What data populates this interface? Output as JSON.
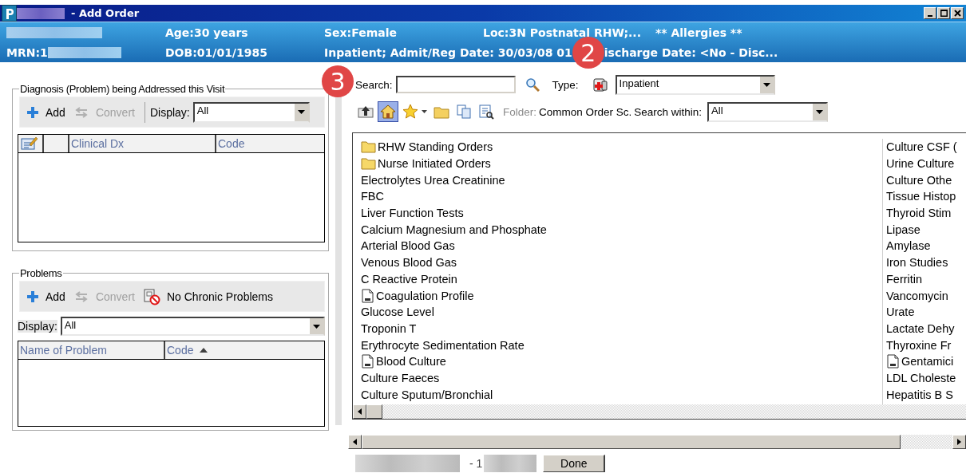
{
  "window": {
    "title": "- Add Order"
  },
  "banner": {
    "age": "Age:30 years",
    "sex": "Sex:Female",
    "location": "Loc:3N Postnatal RHW;...",
    "allergies": "** Allergies **",
    "mrn": "MRN:1",
    "dob": "DOB:01/01/1985",
    "encounter": "Inpatient; Admit/Reg Date: 30/03/08 01",
    "discharge": "ischarge Date: <No - Disc...",
    "callout": "2"
  },
  "diagnosis": {
    "title": "Diagnosis (Problem) being Addressed this Visit",
    "callout": "3",
    "toolbar": [
      {
        "kind": "add",
        "label": "Add",
        "disabled": false
      },
      {
        "kind": "convert",
        "label": "Convert",
        "disabled": true
      }
    ],
    "display_label": "Display:",
    "display_value": "All",
    "columns": [
      {
        "label": "Clinical Dx",
        "sorted": false
      },
      {
        "label": "Code",
        "sorted": false
      }
    ]
  },
  "problems": {
    "title": "Problems",
    "toolbar": [
      {
        "kind": "add",
        "label": "Add",
        "disabled": false
      },
      {
        "kind": "convert",
        "label": "Convert",
        "disabled": true
      },
      {
        "kind": "no-chronic",
        "label": "No Chronic Problems",
        "disabled": false
      }
    ],
    "display_label": "Display:",
    "display_value": "All",
    "columns": [
      {
        "label": "Name of Problem",
        "sorted": false
      },
      {
        "label": "Code",
        "sorted": true
      }
    ]
  },
  "orders": {
    "search_label": "Search:",
    "type_label": "Type:",
    "type_value": "Inpatient",
    "nav_buttons": [
      {
        "kind": "up",
        "selected": false
      },
      {
        "kind": "home",
        "selected": true
      },
      {
        "kind": "favorites",
        "selected": false
      },
      {
        "kind": "folder",
        "selected": false
      },
      {
        "kind": "copy",
        "selected": false
      },
      {
        "kind": "find",
        "selected": false
      }
    ],
    "folder_label": "Folder:",
    "folder_value": "Common Order Sc.",
    "search_within_label": "Search within:",
    "search_within_value": "All",
    "columns": [
      [
        {
          "kind": "folder",
          "text": "RHW Standing Orders"
        },
        {
          "kind": "folder",
          "text": "Nurse Initiated Orders"
        },
        {
          "kind": "order",
          "text": "Electrolytes Urea Creatinine"
        },
        {
          "kind": "order",
          "text": "FBC"
        },
        {
          "kind": "order",
          "text": "Liver Function Tests"
        },
        {
          "kind": "order",
          "text": "Calcium Magnesium and Phosphate"
        },
        {
          "kind": "order",
          "text": "Arterial Blood Gas"
        },
        {
          "kind": "order",
          "text": "Venous Blood Gas"
        },
        {
          "kind": "order",
          "text": "C Reactive Protein"
        },
        {
          "kind": "set",
          "text": "Coagulation Profile"
        },
        {
          "kind": "order",
          "text": "Glucose Level"
        },
        {
          "kind": "order",
          "text": "Troponin T"
        },
        {
          "kind": "order",
          "text": "Erythrocyte Sedimentation Rate"
        },
        {
          "kind": "set",
          "text": "Blood Culture"
        },
        {
          "kind": "order",
          "text": "Culture Faeces"
        },
        {
          "kind": "order",
          "text": "Culture Sputum/Bronchial"
        }
      ],
      [
        {
          "kind": "order",
          "text": "Culture CSF ("
        },
        {
          "kind": "order",
          "text": "Urine Culture"
        },
        {
          "kind": "order",
          "text": "Culture Othe"
        },
        {
          "kind": "order",
          "text": "Tissue Histop"
        },
        {
          "kind": "order",
          "text": "Thyroid Stim"
        },
        {
          "kind": "order",
          "text": "Lipase"
        },
        {
          "kind": "order",
          "text": "Amylase"
        },
        {
          "kind": "order",
          "text": "Iron Studies"
        },
        {
          "kind": "order",
          "text": "Ferritin"
        },
        {
          "kind": "order",
          "text": "Vancomycin"
        },
        {
          "kind": "order",
          "text": "Urate"
        },
        {
          "kind": "order",
          "text": "Lactate Dehy"
        },
        {
          "kind": "order",
          "text": "Thyroxine Fr"
        },
        {
          "kind": "set",
          "text": "Gentamici"
        },
        {
          "kind": "order",
          "text": "LDL Choleste"
        },
        {
          "kind": "order",
          "text": "Hepatitis B S"
        }
      ]
    ]
  },
  "footer": {
    "page_text": "- 1",
    "done": "Done"
  }
}
